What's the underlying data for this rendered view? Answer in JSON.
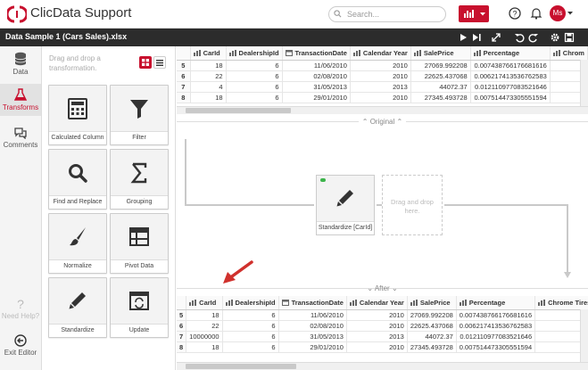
{
  "app": {
    "title": "ClicData Support",
    "brand_color": "#c8102e"
  },
  "header": {
    "search_placeholder": "Search...",
    "avatar_initials": "Ms"
  },
  "toolbar": {
    "file_title": "Data Sample 1 (Cars Sales).xlsx"
  },
  "rail": {
    "items": [
      {
        "label": "Data",
        "icon": "database-icon"
      },
      {
        "label": "Transforms",
        "icon": "flask-icon"
      },
      {
        "label": "Comments",
        "icon": "comments-icon"
      },
      {
        "label": "Need Help?",
        "icon": "question-icon"
      },
      {
        "label": "Exit Editor",
        "icon": "exit-icon"
      }
    ]
  },
  "palette": {
    "hint": "Drag and drop a transformation.",
    "tiles": [
      {
        "label": "Calculated Column",
        "icon": "calculator-icon"
      },
      {
        "label": "Filter",
        "icon": "filter-icon"
      },
      {
        "label": "Find and Replace",
        "icon": "magnifier-icon"
      },
      {
        "label": "Grouping",
        "icon": "sigma-icon"
      },
      {
        "label": "Normalize",
        "icon": "brush-icon"
      },
      {
        "label": "Pivot Data",
        "icon": "pivot-table-icon"
      },
      {
        "label": "Standardize",
        "icon": "pencil-icon"
      },
      {
        "label": "Update",
        "icon": "update-icon"
      }
    ]
  },
  "original_grid": {
    "columns": [
      "CarId",
      "DealershipId",
      "TransactionDate",
      "Calendar Year",
      "SalePrice",
      "Percentage",
      "Chrom"
    ],
    "rows": [
      [
        "5",
        "18",
        "6",
        "11/06/2010",
        "2010",
        "27069.992208",
        "0.007438766176681616",
        ""
      ],
      [
        "6",
        "22",
        "6",
        "02/08/2010",
        "2010",
        "22625.437068",
        "0.006217413536762583",
        ""
      ],
      [
        "7",
        "4",
        "6",
        "31/05/2013",
        "2013",
        "44072.37",
        "0.012110977083521646",
        ""
      ],
      [
        "8",
        "18",
        "6",
        "29/01/2010",
        "2010",
        "27345.493728",
        "0.007514473305551594",
        ""
      ]
    ]
  },
  "flow": {
    "original_label": "⌃ Original ⌃",
    "after_label": "⌄ After ⌄",
    "step_label": "Standardize [CarId]",
    "drop_text": "Drag and drop here."
  },
  "after_grid": {
    "columns": [
      "CarId",
      "DealershipId",
      "TransactionDate",
      "Calendar Year",
      "SalePrice",
      "Percentage",
      "Chrome Tires"
    ],
    "rows": [
      [
        "5",
        "18",
        "6",
        "11/06/2010",
        "2010",
        "27069.992208",
        "0.007438766176681616",
        ""
      ],
      [
        "6",
        "22",
        "6",
        "02/08/2010",
        "2010",
        "22625.437068",
        "0.006217413536762583",
        ""
      ],
      [
        "7",
        "10000000",
        "6",
        "31/05/2013",
        "2013",
        "44072.37",
        "0.012110977083521646",
        ""
      ],
      [
        "8",
        "18",
        "6",
        "29/01/2010",
        "2010",
        "27345.493728",
        "0.007514473305551594",
        ""
      ]
    ]
  }
}
